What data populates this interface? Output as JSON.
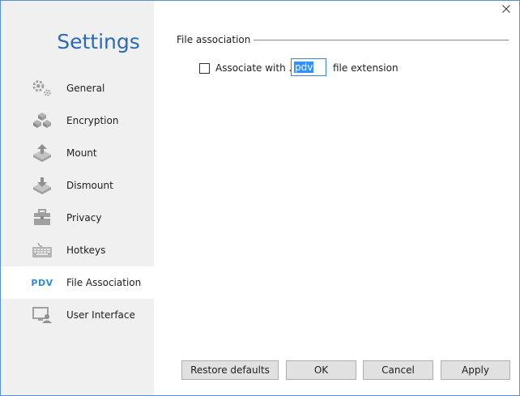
{
  "sidebar": {
    "title": "Settings",
    "items": [
      {
        "label": "General",
        "icon": "gears-icon",
        "active": false
      },
      {
        "label": "Encryption",
        "icon": "cubes-icon",
        "active": false
      },
      {
        "label": "Mount",
        "icon": "mount-icon",
        "active": false
      },
      {
        "label": "Dismount",
        "icon": "dismount-icon",
        "active": false
      },
      {
        "label": "Privacy",
        "icon": "briefcase-icon",
        "active": false
      },
      {
        "label": "Hotkeys",
        "icon": "keyboard-icon",
        "active": false
      },
      {
        "label": "File Association",
        "icon": "pdv-icon",
        "icon_text": "PDV",
        "active": true
      },
      {
        "label": "User Interface",
        "icon": "user-interface-icon",
        "active": false
      }
    ]
  },
  "main": {
    "group_title": "File association",
    "associate": {
      "checked": false,
      "label_prefix": "Associate with .",
      "extension_value": "pdv",
      "label_suffix": "file extension"
    }
  },
  "buttons": {
    "restore": "Restore defaults",
    "ok": "OK",
    "cancel": "Cancel",
    "apply": "Apply"
  },
  "colors": {
    "accent": "#2a6cb4",
    "pdv": "#2a8be0",
    "sidebar_bg": "#f0f0f0",
    "icon_gray": "#a0a0a0"
  }
}
